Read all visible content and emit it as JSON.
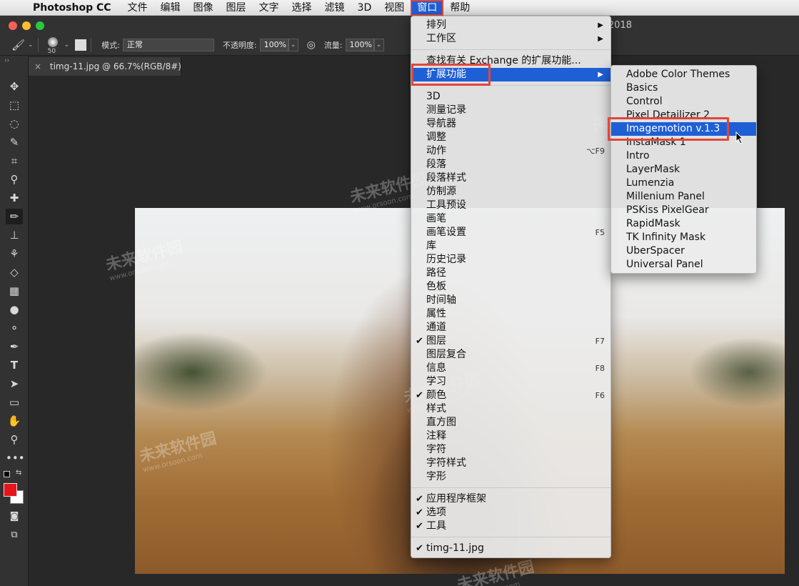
{
  "menubar": {
    "app_name": "Photoshop CC",
    "items": [
      "文件",
      "编辑",
      "图像",
      "图层",
      "文字",
      "选择",
      "滤镜",
      "3D",
      "视图",
      "窗口",
      "帮助"
    ]
  },
  "window": {
    "title_suffix": "2018"
  },
  "options_bar": {
    "brush_size": "50",
    "mode_label": "模式:",
    "mode_value": "正常",
    "opacity_label": "不透明度:",
    "opacity_value": "100%",
    "flow_label": "流量:",
    "flow_value": "100%"
  },
  "document_tab": {
    "title": "timg-11.jpg @ 66.7%(RGB/8#)"
  },
  "window_menu": {
    "items": [
      {
        "label": "排列",
        "submenu": true
      },
      {
        "label": "工作区",
        "submenu": true
      },
      {
        "label": "查找有关 Exchange 的扩展功能..."
      },
      {
        "label": "扩展功能",
        "submenu": true,
        "highlighted": true
      },
      {
        "label": "3D"
      },
      {
        "label": "测量记录"
      },
      {
        "label": "导航器"
      },
      {
        "label": "调整"
      },
      {
        "label": "动作",
        "shortcut": "⌥F9"
      },
      {
        "label": "段落"
      },
      {
        "label": "段落样式"
      },
      {
        "label": "仿制源"
      },
      {
        "label": "工具预设"
      },
      {
        "label": "画笔"
      },
      {
        "label": "画笔设置",
        "shortcut": "F5"
      },
      {
        "label": "库"
      },
      {
        "label": "历史记录"
      },
      {
        "label": "路径"
      },
      {
        "label": "色板"
      },
      {
        "label": "时间轴"
      },
      {
        "label": "属性"
      },
      {
        "label": "通道"
      },
      {
        "label": "图层",
        "shortcut": "F7",
        "checked": true
      },
      {
        "label": "图层复合"
      },
      {
        "label": "信息",
        "shortcut": "F8"
      },
      {
        "label": "学习"
      },
      {
        "label": "颜色",
        "shortcut": "F6",
        "checked": true
      },
      {
        "label": "样式"
      },
      {
        "label": "直方图"
      },
      {
        "label": "注释"
      },
      {
        "label": "字符"
      },
      {
        "label": "字符样式"
      },
      {
        "label": "字形"
      },
      {
        "label": "应用程序框架",
        "checked": true
      },
      {
        "label": "选项",
        "checked": true
      },
      {
        "label": "工具",
        "checked": true
      },
      {
        "label": "timg-11.jpg",
        "checked": true
      }
    ]
  },
  "extensions_menu": {
    "items": [
      {
        "label": "Adobe Color Themes"
      },
      {
        "label": "Basics"
      },
      {
        "label": "Control"
      },
      {
        "label": "Pixel Detailizer 2"
      },
      {
        "label": "Imagemotion v.1.3",
        "highlighted": true
      },
      {
        "label": "InstaMask 1"
      },
      {
        "label": "Intro"
      },
      {
        "label": "LayerMask"
      },
      {
        "label": "Lumenzia"
      },
      {
        "label": "Millenium Panel"
      },
      {
        "label": "PSKiss PixelGear"
      },
      {
        "label": "RapidMask"
      },
      {
        "label": "TK Infinity Mask"
      },
      {
        "label": "UberSpacer"
      },
      {
        "label": "Universal Panel"
      }
    ]
  },
  "watermark": {
    "brand": "未来软件园",
    "url": "www.orsoon.com"
  },
  "colors": {
    "foreground": "#e8141c",
    "background": "#ffffff",
    "highlight": "#1f5fd6",
    "callout": "#e0463c"
  }
}
